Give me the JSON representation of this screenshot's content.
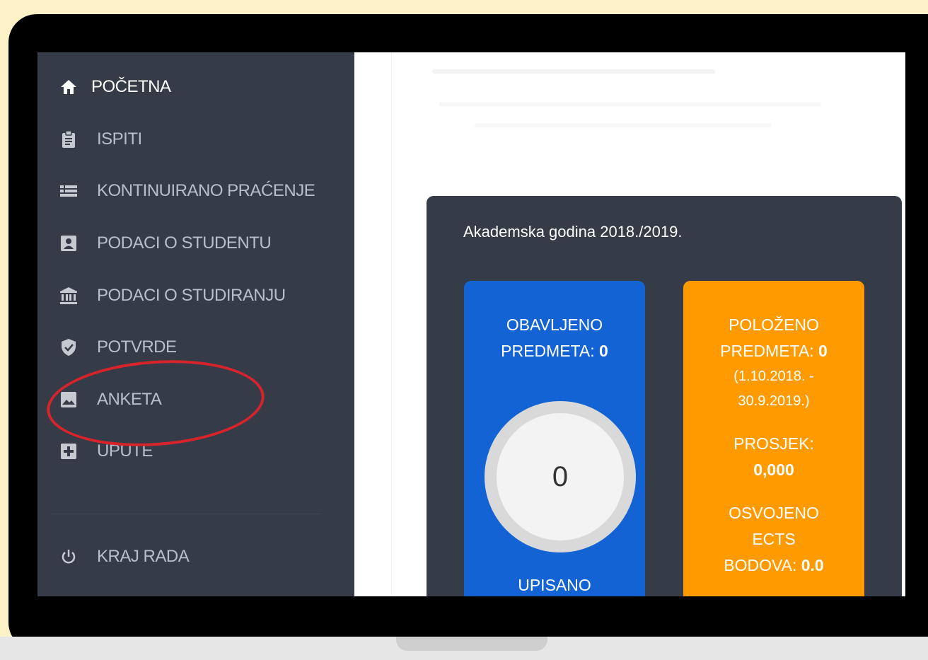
{
  "sidebar": {
    "items": [
      {
        "label": "POČETNA",
        "icon": "home-icon"
      },
      {
        "label": "ISPITI",
        "icon": "clipboard-icon"
      },
      {
        "label": "KONTINUIRANO PRAĆENJE",
        "icon": "list-icon"
      },
      {
        "label": "PODACI O STUDENTU",
        "icon": "id-card-icon"
      },
      {
        "label": "PODACI O STUDIRANJU",
        "icon": "bank-icon"
      },
      {
        "label": "POTVRDE",
        "icon": "shield-check-icon"
      },
      {
        "label": "ANKETA",
        "icon": "image-icon"
      },
      {
        "label": "UPUTE",
        "icon": "plus-box-icon"
      }
    ],
    "logout": {
      "label": "KRAJ RADA",
      "icon": "power-icon"
    }
  },
  "panel": {
    "title": "Akademska godina 2018./2019.",
    "blue_card": {
      "line1": "OBAVLJENO",
      "line2_label": "PREDMETA:",
      "line2_value": "0",
      "gauge_value": "0",
      "footer": "UPISANO"
    },
    "orange_card": {
      "line1": "POLOŽENO",
      "line2_label": "PREDMETA:",
      "line2_value": "0",
      "date_line1": "(1.10.2018. -",
      "date_line2": "30.9.2019.)",
      "avg_label": "PROSJEK:",
      "avg_value": "0,000",
      "ects_line1": "OSVOJENO",
      "ects_line2": "ECTS",
      "ects_label": "BODOVA:",
      "ects_value": "0.0"
    }
  },
  "colors": {
    "sidebar_bg": "#353c47",
    "card_blue": "#1363d4",
    "card_orange": "#ff9a00",
    "highlight": "#d9232b",
    "background": "#fdf1c7"
  }
}
